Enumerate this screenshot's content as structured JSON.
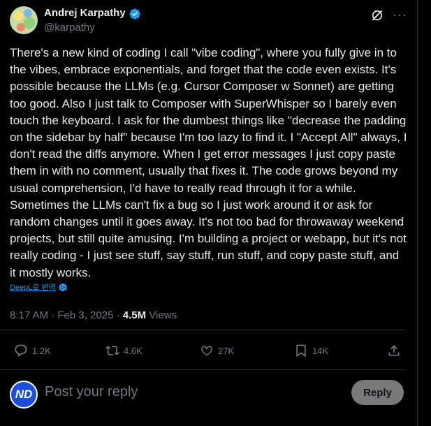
{
  "author": {
    "name": "Andrej Karpathy",
    "handle": "@karpathy",
    "verified": true,
    "accent_color": "#1d9bf0"
  },
  "header_icons": [
    "grok-icon",
    "more-icon"
  ],
  "more_label": "···",
  "tweet": {
    "text": "There's a new kind of coding I call \"vibe coding\", where you fully give in to the vibes, embrace exponentials, and forget that the code even exists. It's possible because the LLMs (e.g. Cursor Composer w Sonnet) are getting too good. Also I just talk to Composer with SuperWhisper so I barely even touch the keyboard. I ask for the dumbest things like \"decrease the padding on the sidebar by half\" because I'm too lazy to find it. I \"Accept All\" always, I don't read the diffs anymore. When I get error messages I just copy paste them in with no comment, usually that fixes it. The code grows beyond my usual comprehension, I'd have to really read through it for a while. Sometimes the LLMs can't fix a bug so I just work around it or ask for random changes until it goes away. It's not too bad for throwaway weekend projects, but still quite amusing. I'm building a project or webapp, but it's not really coding - I just see stuff, say stuff, run stuff, and copy paste stuff, and it mostly works.",
    "translate_label": "DeepL로 번역"
  },
  "meta": {
    "time": "8:17 AM",
    "separator": "·",
    "date": "Feb 3, 2025",
    "sep2": "·",
    "views_count": "4.5M",
    "views_label": "Views"
  },
  "actions": {
    "replies": "1.2K",
    "reposts": "4.6K",
    "likes": "27K",
    "bookmarks": "14K"
  },
  "reply_box": {
    "avatar_text": "ND",
    "placeholder": "Post your reply",
    "button_label": "Reply"
  }
}
